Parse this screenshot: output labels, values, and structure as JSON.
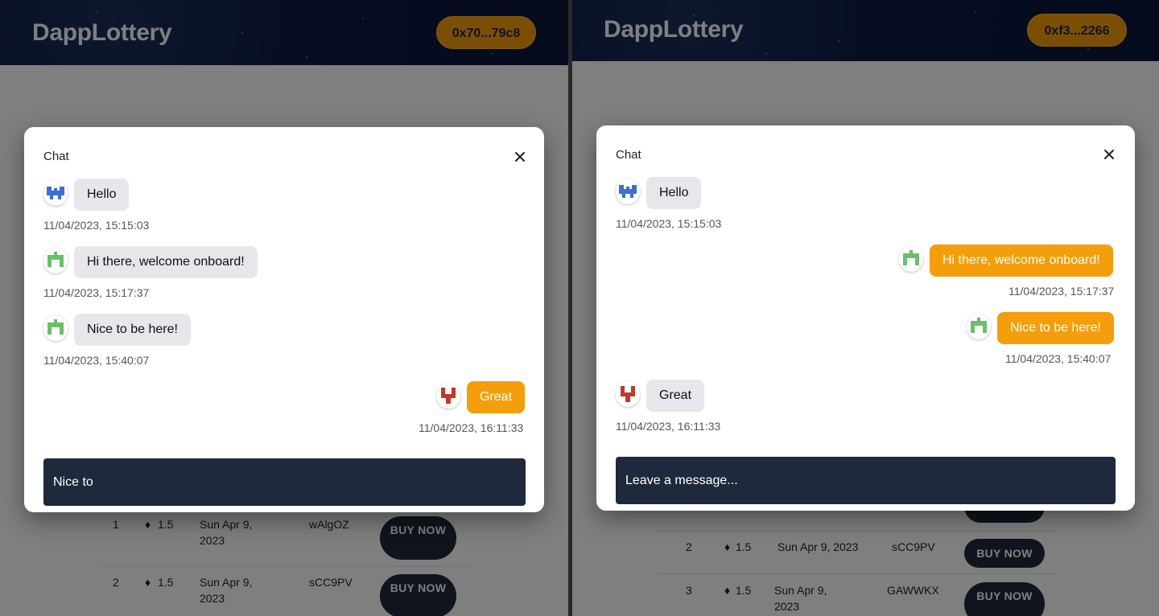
{
  "left": {
    "brand": "DappLottery",
    "wallet": "0x70...79c8",
    "chat": {
      "title": "Chat",
      "messages": [
        {
          "text": "Hello",
          "time": "11/04/2023, 15:15:03",
          "mine": false,
          "avatar": "blue"
        },
        {
          "text": "Hi there, welcome onboard!",
          "time": "11/04/2023, 15:17:37",
          "mine": false,
          "avatar": "green"
        },
        {
          "text": "Nice to be here!",
          "time": "11/04/2023, 15:40:07",
          "mine": false,
          "avatar": "green"
        },
        {
          "text": "Great",
          "time": "11/04/2023, 16:11:33",
          "mine": true,
          "avatar": "red"
        }
      ],
      "input_value": "Nice to"
    },
    "table_rows": [
      {
        "id": "1",
        "price": "1.5",
        "date": "Sun Apr 9, 2023",
        "number": "wAlgOZ",
        "action": "BUY NOW"
      },
      {
        "id": "2",
        "price": "1.5",
        "date": "Sun Apr 9, 2023",
        "number": "sCC9PV",
        "action": "BUY NOW"
      }
    ]
  },
  "right": {
    "brand": "DappLottery",
    "wallet": "0xf3...2266",
    "chat": {
      "title": "Chat",
      "messages": [
        {
          "text": "Hello",
          "time": "11/04/2023, 15:15:03",
          "mine": false,
          "avatar": "blue"
        },
        {
          "text": "Hi there, welcome onboard!",
          "time": "11/04/2023, 15:17:37",
          "mine": true,
          "avatar": "green"
        },
        {
          "text": "Nice to be here!",
          "time": "11/04/2023, 15:40:07",
          "mine": true,
          "avatar": "green"
        },
        {
          "text": "Great",
          "time": "11/04/2023, 16:11:33",
          "mine": false,
          "avatar": "red"
        }
      ],
      "input_placeholder": "Leave a message..."
    },
    "table_rows": [
      {
        "id": "2",
        "price": "1.5",
        "date": "Sun Apr 9, 2023",
        "number": "sCC9PV",
        "action": "BUY NOW"
      },
      {
        "id": "3",
        "price": "1.5",
        "date": "Sun Apr 9, 2023",
        "number": "GAWWKX",
        "action": "BUY NOW"
      }
    ]
  },
  "colors": {
    "accent": "#f59e0b",
    "header_bg": "#0e1c44",
    "input_bg": "#1e293b",
    "bubble_in": "#e5e7eb",
    "avatar_blue": "#3b6fd6",
    "avatar_green": "#6bbf6a",
    "avatar_red": "#c0392b"
  },
  "icons": {
    "close": "close-icon",
    "eth": "ethereum-icon"
  }
}
